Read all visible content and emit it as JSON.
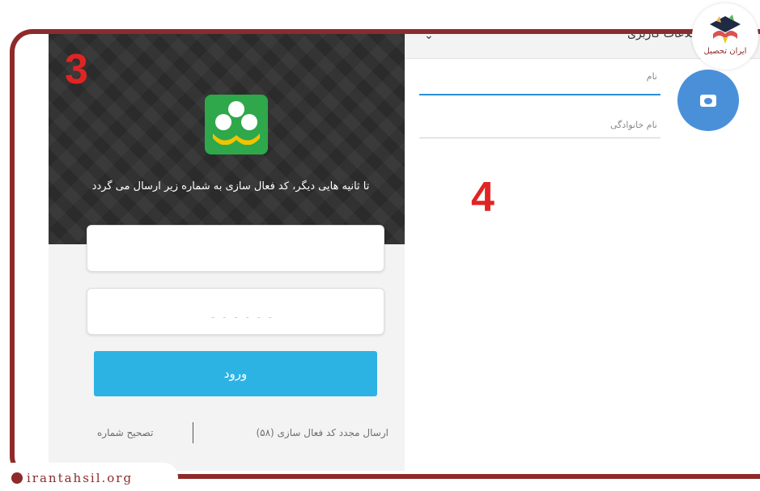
{
  "step3_label": "3",
  "step4_label": "4",
  "activation": {
    "notice": "تا ثانیه هایی دیگر، کد فعال سازی به شماره زیر ارسال می گردد",
    "phone_value": "",
    "code_placeholder": "- - - - - -",
    "login_label": "ورود",
    "resend_label": "ارسال مجدد کد فعال سازی (۵۸)",
    "fix_number_label": "تصحیح شماره"
  },
  "profile": {
    "header_title": "اطلاعات کاربری",
    "first_name_placeholder": "نام",
    "last_name_placeholder": "نام خانوادگی"
  },
  "brand": {
    "name": "ایران تحصیل",
    "watermark": "irantahsil.org"
  },
  "colors": {
    "accent_blue": "#2db3e3",
    "camera_blue": "#4a90d9",
    "frame_brown": "#8e2a2a",
    "step_red": "#e02424",
    "logo_green": "#2ea84a",
    "logo_yellow": "#f2c300"
  }
}
